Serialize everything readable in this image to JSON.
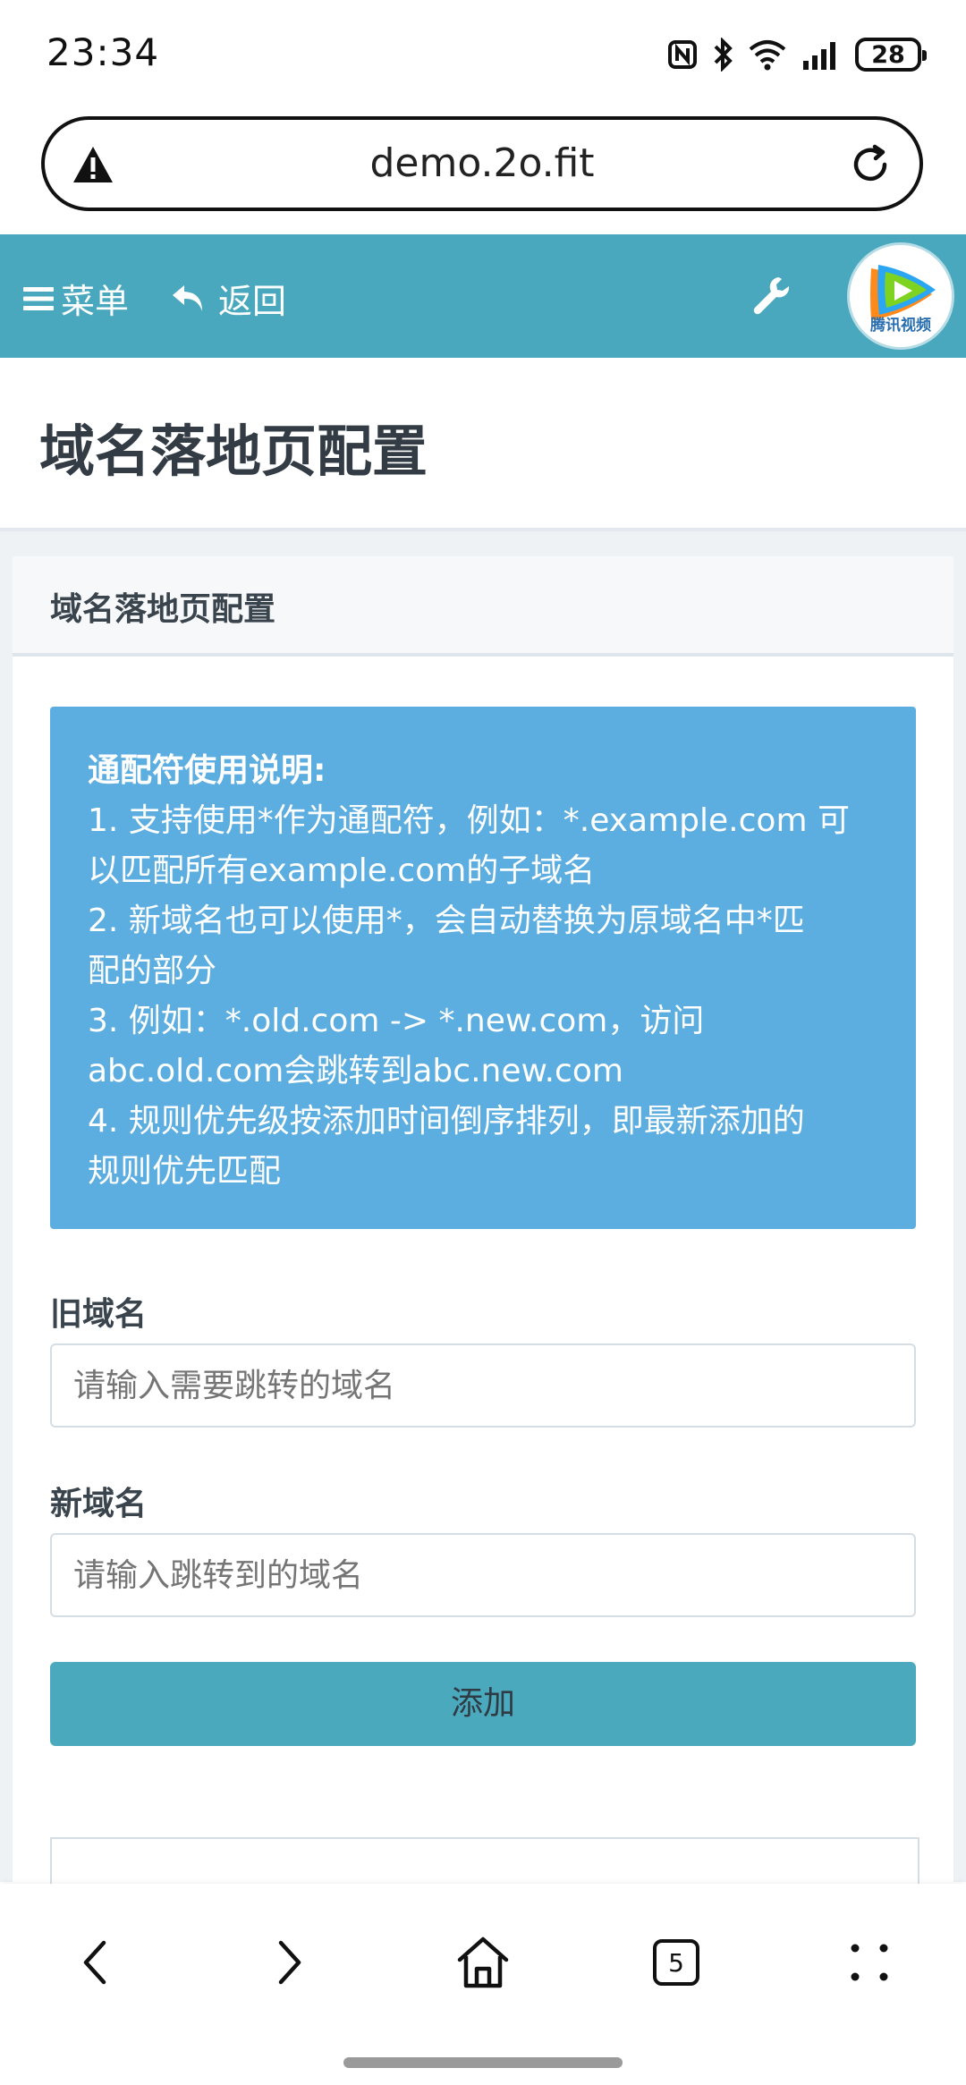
{
  "status_bar": {
    "time": "23:34",
    "battery": "28",
    "icons": [
      "nfc-icon",
      "bluetooth-icon",
      "wifi-icon",
      "signal-icon",
      "battery-icon"
    ]
  },
  "browser": {
    "url": "demo.2o.fit",
    "tab_count": "5"
  },
  "header": {
    "menu_label": "菜单",
    "back_label": "返回",
    "avatar_text": "腾讯视频",
    "accent_color": "#49a8bd"
  },
  "page": {
    "title": "域名落地页配置"
  },
  "card": {
    "title": "域名落地页配置",
    "info": {
      "title": "通配符使用说明:",
      "lines": [
        "1. 支持使用*作为通配符，例如：*.example.com 可",
        "以匹配所有example.com的子域名",
        "2. 新域名也可以使用*，会自动替换为原域名中*匹",
        "配的部分",
        "3. 例如：*.old.com -> *.new.com，访问",
        "abc.old.com会跳转到abc.new.com",
        "4. 规则优先级按添加时间倒序排列，即最新添加的",
        "规则优先匹配"
      ],
      "color": "#5cade0"
    },
    "old_domain": {
      "label": "旧域名",
      "placeholder": "请输入需要跳转的域名",
      "value": ""
    },
    "new_domain": {
      "label": "新域名",
      "placeholder": "请输入跳转到的域名",
      "value": ""
    },
    "add_button": "添加"
  }
}
